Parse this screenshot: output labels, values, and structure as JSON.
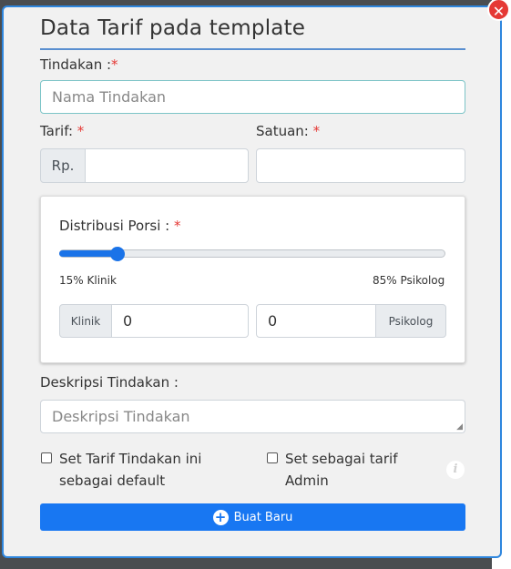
{
  "modal": {
    "title": "Data Tarif pada template",
    "close_icon": "close-icon"
  },
  "tindakan": {
    "label": "Tindakan :",
    "required_mark": "*",
    "placeholder": "Nama Tindakan"
  },
  "tarif": {
    "label": "Tarif:",
    "required_mark": "*",
    "prefix": "Rp.",
    "value": ""
  },
  "satuan": {
    "label": "Satuan:",
    "required_mark": "*",
    "value": ""
  },
  "distribusi": {
    "label": "Distribusi Porsi :",
    "required_mark": "*",
    "slider_value_percent": 15,
    "left_caption": "15% Klinik",
    "right_caption": "85% Psikolog",
    "klinik_addon": "Klinik",
    "klinik_value": "0",
    "psikolog_value": "0",
    "psikolog_addon": "Psikolog"
  },
  "deskripsi": {
    "label": "Deskripsi Tindakan :",
    "placeholder": "Deskripsi Tindakan"
  },
  "options": {
    "default_line1": "Set Tarif Tindakan ini",
    "default_line2": "sebagai default",
    "admin_line1": "Set sebagai tarif",
    "admin_line2": "Admin",
    "info_icon": "info-icon"
  },
  "submit": {
    "label": "Buat Baru",
    "icon": "plus-circle-icon"
  },
  "colors": {
    "primary": "#1877f2",
    "danger": "#e53935"
  }
}
